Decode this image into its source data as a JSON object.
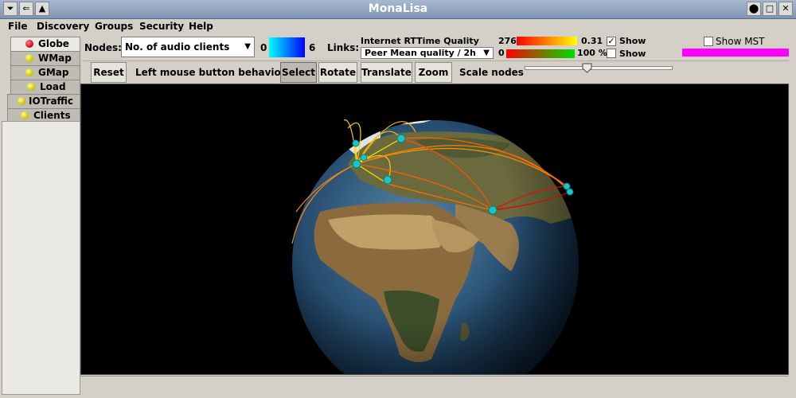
{
  "window": {
    "title": "MonaLisa",
    "buttons": [
      "⏷",
      "⇐",
      "▲"
    ],
    "right_buttons": [
      "⬤",
      "□",
      "✕"
    ]
  },
  "menu": [
    {
      "label": "File"
    },
    {
      "label": "Discovery"
    },
    {
      "label": "Groups"
    },
    {
      "label": "Security"
    },
    {
      "label": "Help"
    }
  ],
  "tabs": [
    {
      "label": "Globe",
      "active": true,
      "color": "red"
    },
    {
      "label": "WMap",
      "active": false,
      "color": "yellow"
    },
    {
      "label": "GMap",
      "active": false,
      "color": "yellow"
    },
    {
      "label": "Load",
      "active": false,
      "color": "yellow"
    },
    {
      "label": "IOTraffic",
      "active": false,
      "color": "yellow"
    },
    {
      "label": "Clients",
      "active": false,
      "color": "yellow"
    }
  ],
  "nodes": {
    "label": "Nodes:",
    "selected": "No. of audio clients",
    "min": "0",
    "max": "6",
    "gradient": [
      "#00ffff",
      "#0000ff"
    ]
  },
  "links": {
    "label": "Links:",
    "row1": {
      "title": "Internet RTTime Quality",
      "min": "276",
      "max": "0.31",
      "show_label": "Show",
      "show_checked": true,
      "gradient": [
        "#ff0000",
        "#ffff00"
      ]
    },
    "row2": {
      "selected": "Peer Mean quality / 2h",
      "min": "0",
      "max": "100 %",
      "show_label": "Show",
      "show_checked": false,
      "gradient": [
        "#ff0000",
        "#00dd00"
      ]
    }
  },
  "mst": {
    "label": "Show MST",
    "checked": false,
    "color": "#ff00ff"
  },
  "toolbar": {
    "reset": "Reset",
    "behavior_label": "Left mouse button behavior:",
    "select": "Select",
    "rotate": "Rotate",
    "translate": "Translate",
    "zoom": "Zoom",
    "scale_label": "Scale nodes",
    "scale_value": 0.42
  },
  "colors": {
    "view_bg": "#000000",
    "node": "#19c6c6",
    "link_warm": "#ffb000",
    "link_cool": "#ff3000"
  }
}
